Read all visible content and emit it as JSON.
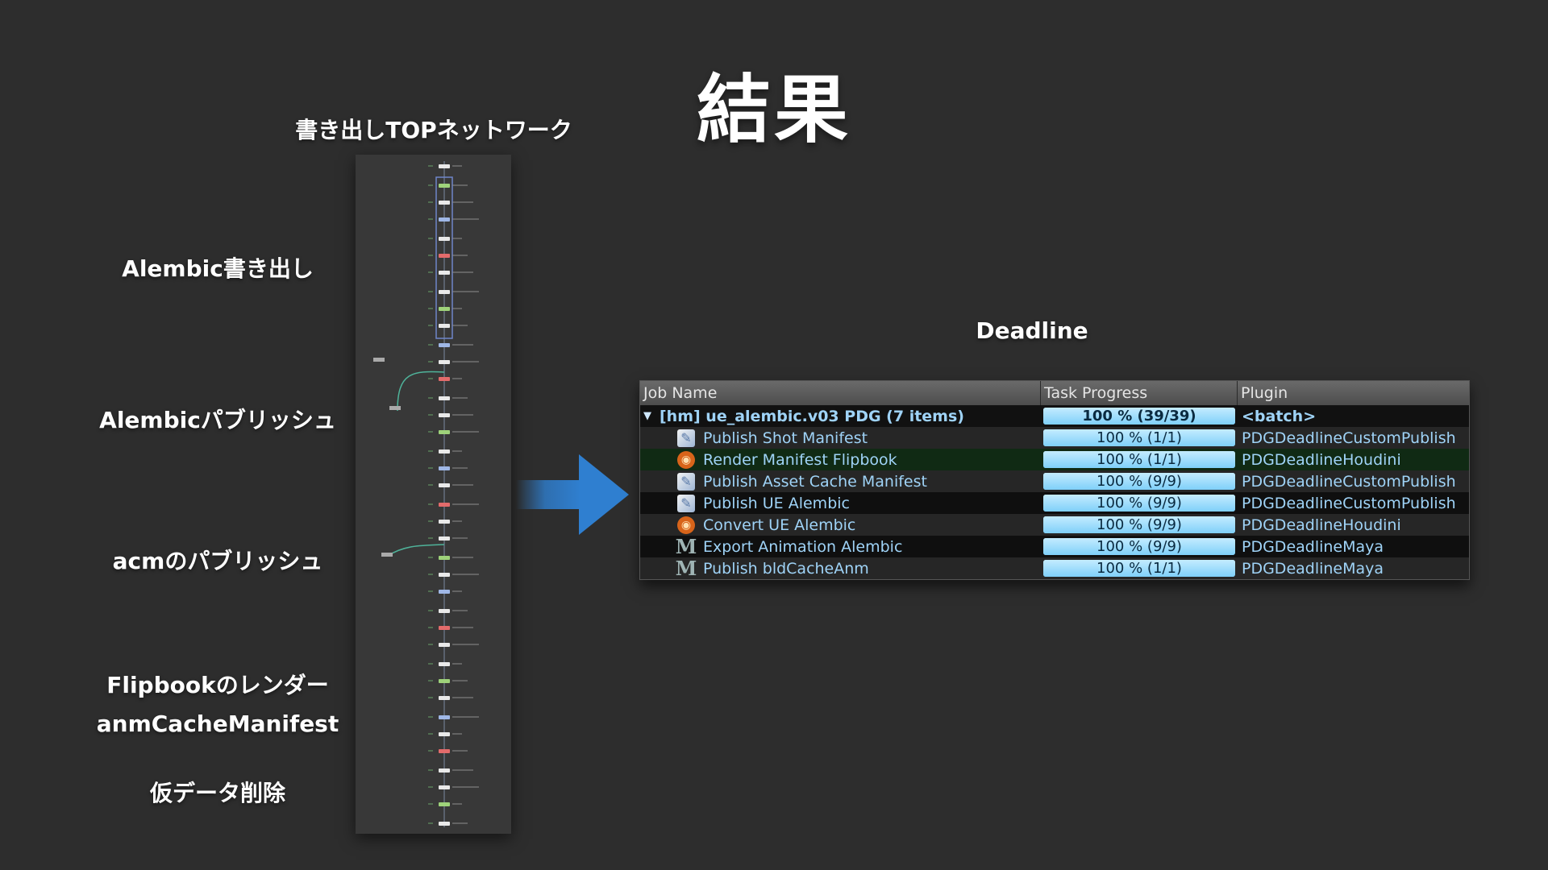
{
  "slide": {
    "title": "結果",
    "network_label": "書き出しTOPネットワーク",
    "deadline_label": "Deadline",
    "side_labels": [
      "Alembic書き出し",
      "Alembicパブリッシュ",
      "acmのパブリッシュ",
      "Flipbookのレンダー",
      "anmCacheManifest",
      "仮データ削除"
    ]
  },
  "colors": {
    "background": "#2d2d2d",
    "arrow": "#2f7fd0",
    "progress_bar": "#7fd0f9",
    "job_text": "#9fd3f7"
  },
  "table": {
    "headers": [
      "Job Name",
      "Task Progress",
      "Plugin"
    ],
    "batch": {
      "expander": "▼",
      "name": "[hm] ue_alembic.v03 PDG (7 items)",
      "progress_text": "100 % (39/39)",
      "progress": 1.0,
      "plugin": "<batch>"
    },
    "rows": [
      {
        "icon": "publish-icon",
        "name": "Publish Shot Manifest",
        "progress_text": "100 %   (1/1)",
        "progress": 1.0,
        "plugin": "PDGDeadlineCustomPublish"
      },
      {
        "icon": "houdini-icon",
        "name": "Render Manifest Flipbook",
        "progress_text": "100 %   (1/1)",
        "progress": 1.0,
        "plugin": "PDGDeadlineHoudini"
      },
      {
        "icon": "publish-icon",
        "name": "Publish Asset Cache Manifest",
        "progress_text": "100 %   (9/9)",
        "progress": 1.0,
        "plugin": "PDGDeadlineCustomPublish"
      },
      {
        "icon": "publish-icon",
        "name": "Publish UE Alembic",
        "progress_text": "100 %   (9/9)",
        "progress": 1.0,
        "plugin": "PDGDeadlineCustomPublish"
      },
      {
        "icon": "houdini-icon",
        "name": "Convert UE Alembic",
        "progress_text": "100 %   (9/9)",
        "progress": 1.0,
        "plugin": "PDGDeadlineHoudini"
      },
      {
        "icon": "maya-icon",
        "name": "Export Animation Alembic",
        "progress_text": "100 %   (9/9)",
        "progress": 1.0,
        "plugin": "PDGDeadlineMaya"
      },
      {
        "icon": "maya-icon",
        "name": "Publish bldCacheAnm",
        "progress_text": "100 %   (1/1)",
        "progress": 1.0,
        "plugin": "PDGDeadlineMaya"
      }
    ]
  }
}
